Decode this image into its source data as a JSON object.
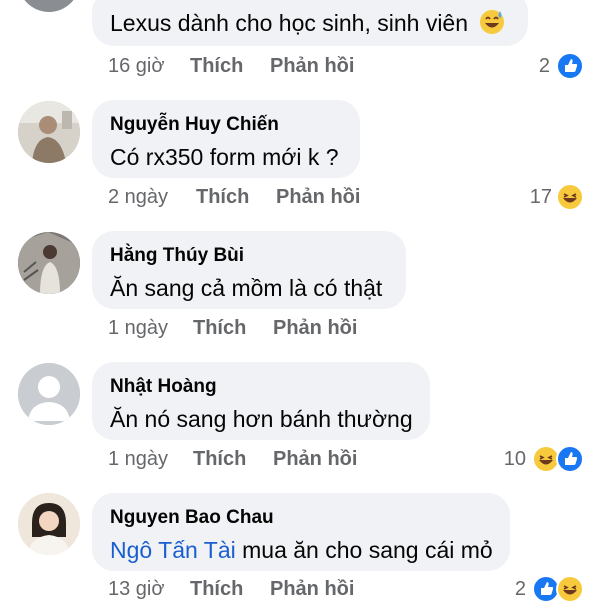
{
  "comments": [
    {
      "author": "",
      "text": "Lexus dành cho học sinh, sinh viên",
      "emoji": "sweat-smile",
      "time": "16 giờ",
      "like_label": "Thích",
      "reply_label": "Phản hồi",
      "reaction_count": "2",
      "reactions": [
        "like"
      ]
    },
    {
      "author": "Nguyễn Huy Chiến",
      "text": "Có rx350 form mới k ?",
      "time": "2 ngày",
      "like_label": "Thích",
      "reply_label": "Phản hồi",
      "reaction_count": "17",
      "reactions": [
        "haha"
      ]
    },
    {
      "author": "Hằng Thúy Bùi",
      "text": "Ăn sang cả mồm là có thật",
      "time": "1 ngày",
      "like_label": "Thích",
      "reply_label": "Phản hồi",
      "reaction_count": "",
      "reactions": []
    },
    {
      "author": "Nhật Hoàng",
      "text": "Ăn nó sang hơn bánh thường",
      "time": "1 ngày",
      "like_label": "Thích",
      "reply_label": "Phản hồi",
      "reaction_count": "10",
      "reactions": [
        "haha",
        "like"
      ]
    },
    {
      "author": "Nguyen Bao Chau",
      "mention": "Ngô Tấn Tài",
      "text": "mua ăn cho sang cái mỏ",
      "time": "13 giờ",
      "like_label": "Thích",
      "reply_label": "Phản hồi",
      "reaction_count": "2",
      "reactions": [
        "like",
        "haha"
      ]
    }
  ],
  "colors": {
    "bubble": "#f0f2f5",
    "meta": "#65676b",
    "mention": "#1a5fd0",
    "like": "#1877f2",
    "haha": "#f7c93c"
  }
}
